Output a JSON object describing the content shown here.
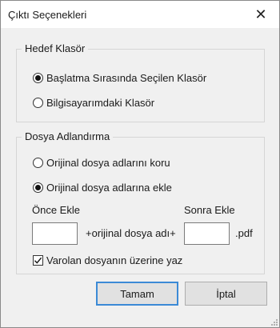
{
  "window": {
    "title": "Çıktı Seçenekleri",
    "close_glyph": "✕"
  },
  "target_folder": {
    "legend": "Hedef Klasör",
    "options": [
      {
        "label": "Başlatma Sırasında Seçilen Klasör",
        "selected": true
      },
      {
        "label": "Bilgisayarımdaki Klasör",
        "selected": false
      }
    ]
  },
  "file_naming": {
    "legend": "Dosya Adlandırma",
    "options": [
      {
        "label": "Orijinal dosya adlarını koru",
        "selected": false
      },
      {
        "label": "Orijinal dosya adlarına ekle",
        "selected": true
      }
    ],
    "prefix_label": "Önce Ekle",
    "suffix_label": "Sonra Ekle",
    "prefix_value": "",
    "suffix_value": "",
    "middle_text": "+orijinal dosya adı+",
    "extension_text": ".pdf",
    "overwrite_label": "Varolan dosyanın üzerine yaz",
    "overwrite_checked": true
  },
  "buttons": {
    "ok": "Tamam",
    "cancel": "İptal"
  }
}
